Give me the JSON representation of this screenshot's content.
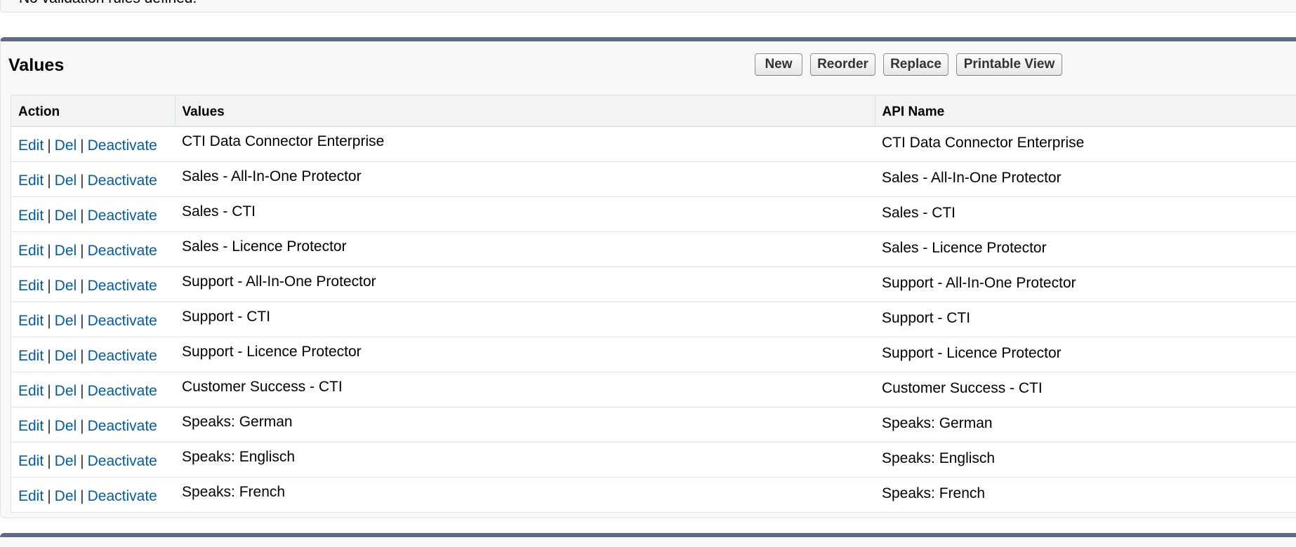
{
  "validation": {
    "message": "No validation rules defined."
  },
  "values_section": {
    "title": "Values",
    "buttons": {
      "new": "New",
      "reorder": "Reorder",
      "replace": "Replace",
      "printable_view": "Printable View"
    },
    "columns": {
      "action": "Action",
      "values": "Values",
      "api_name": "API Name"
    },
    "actions": {
      "edit": "Edit",
      "del": "Del",
      "deactivate": "Deactivate",
      "separator": "|"
    },
    "rows": [
      {
        "value": "CTI Data Connector Enterprise",
        "api_name": "CTI Data Connector Enterprise"
      },
      {
        "value": "Sales - All-In-One Protector",
        "api_name": "Sales - All-In-One Protector"
      },
      {
        "value": "Sales - CTI",
        "api_name": "Sales - CTI"
      },
      {
        "value": "Sales - Licence Protector",
        "api_name": "Sales - Licence Protector"
      },
      {
        "value": "Support - All-In-One Protector",
        "api_name": "Support - All-In-One Protector"
      },
      {
        "value": "Support - CTI",
        "api_name": "Support - CTI"
      },
      {
        "value": "Support - Licence Protector",
        "api_name": "Support - Licence Protector"
      },
      {
        "value": "Customer Success - CTI",
        "api_name": "Customer Success - CTI"
      },
      {
        "value": "Speaks: German",
        "api_name": "Speaks: German"
      },
      {
        "value": "Speaks: Englisch",
        "api_name": "Speaks: Englisch"
      },
      {
        "value": "Speaks: French",
        "api_name": "Speaks: French"
      }
    ]
  },
  "colors": {
    "link": "#015ba7",
    "section_border": "#5d6b87",
    "section_bg": "#f8f8f8",
    "header_bg": "#f2f3f3"
  }
}
